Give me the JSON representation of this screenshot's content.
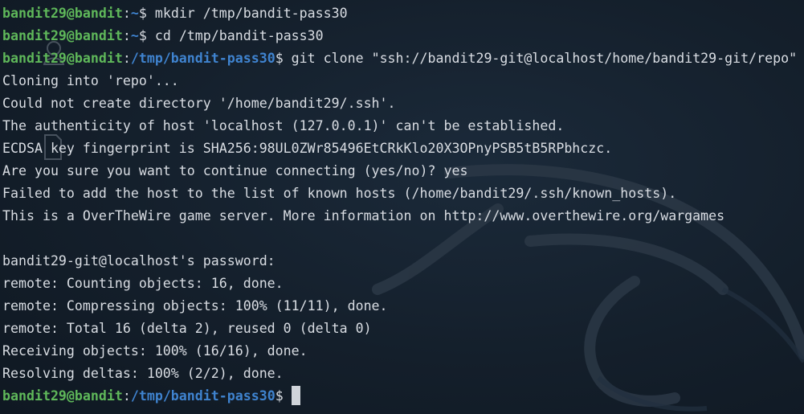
{
  "colors": {
    "prompt_user": "#5fb85a",
    "prompt_path": "#3f83cf",
    "text": "#d9dde3",
    "background": "#141f2b",
    "wallpaper_dragon": "#2a3644"
  },
  "prompt": {
    "user_host": "bandit29@bandit",
    "colon": ":",
    "dollar": "$"
  },
  "lines": [
    {
      "type": "prompt",
      "path": "~",
      "command": " mkdir /tmp/bandit-pass30"
    },
    {
      "type": "prompt",
      "path": "~",
      "command": " cd /tmp/bandit-pass30"
    },
    {
      "type": "prompt",
      "path": "/tmp/bandit-pass30",
      "command": " git clone \"ssh://bandit29-git@localhost/home/bandit29-git/repo\""
    },
    {
      "type": "output",
      "text": "Cloning into 'repo'..."
    },
    {
      "type": "output",
      "text": "Could not create directory '/home/bandit29/.ssh'."
    },
    {
      "type": "output",
      "text": "The authenticity of host 'localhost (127.0.0.1)' can't be established."
    },
    {
      "type": "output",
      "text": "ECDSA key fingerprint is SHA256:98UL0ZWr85496EtCRkKlo20X3OPnyPSB5tB5RPbhczc."
    },
    {
      "type": "output",
      "text": "Are you sure you want to continue connecting (yes/no)? yes"
    },
    {
      "type": "output",
      "text": "Failed to add the host to the list of known hosts (/home/bandit29/.ssh/known_hosts)."
    },
    {
      "type": "output",
      "text": "This is a OverTheWire game server. More information on http://www.overthewire.org/wargames"
    },
    {
      "type": "output",
      "text": ""
    },
    {
      "type": "output",
      "text": "bandit29-git@localhost's password: "
    },
    {
      "type": "output",
      "text": "remote: Counting objects: 16, done."
    },
    {
      "type": "output",
      "text": "remote: Compressing objects: 100% (11/11), done."
    },
    {
      "type": "output",
      "text": "remote: Total 16 (delta 2), reused 0 (delta 0)"
    },
    {
      "type": "output",
      "text": "Receiving objects: 100% (16/16), done."
    },
    {
      "type": "output",
      "text": "Resolving deltas: 100% (2/2), done."
    },
    {
      "type": "prompt",
      "path": "/tmp/bandit-pass30",
      "command": " ",
      "cursor": true
    }
  ],
  "icons": {
    "desktop_icon_1": "user-folder-icon",
    "desktop_icon_2": "file-icon",
    "wallpaper": "kali-dragon-icon"
  }
}
